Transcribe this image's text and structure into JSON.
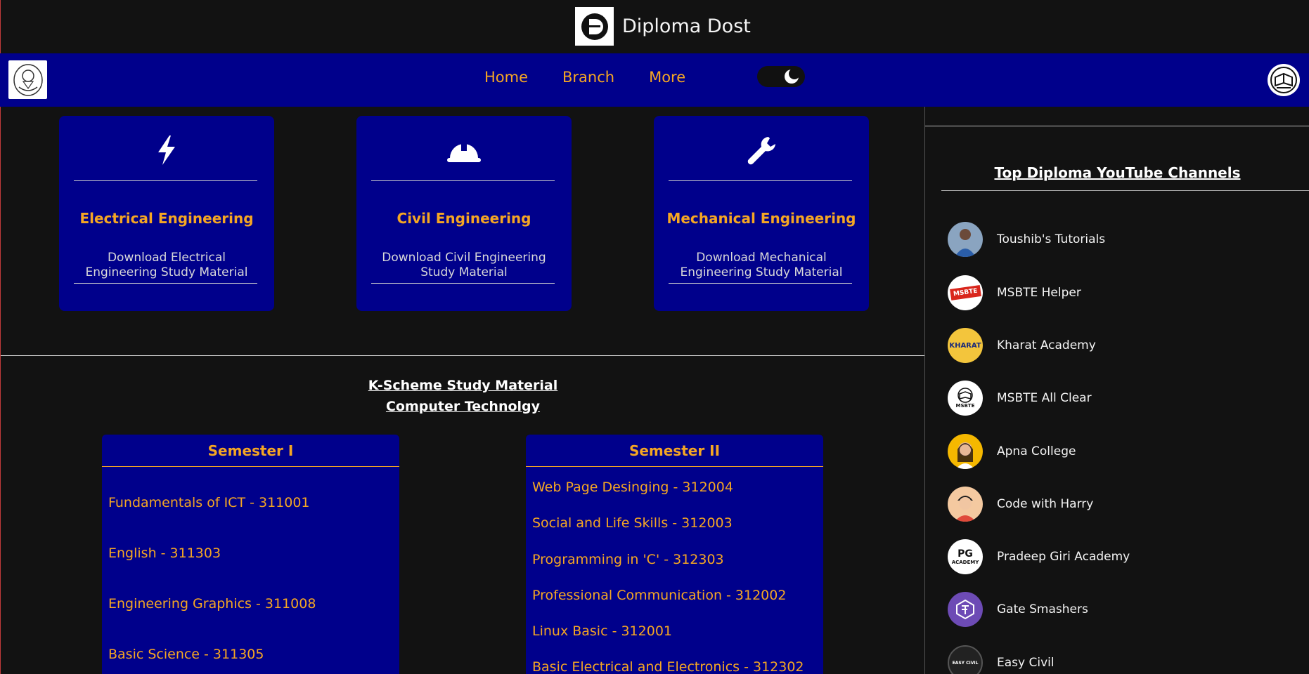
{
  "brand": {
    "name": "Diploma Dost",
    "logo_letter": "D"
  },
  "nav": {
    "links": [
      "Home",
      "Branch",
      "More"
    ],
    "toggle_icon": "moon-icon"
  },
  "branches": [
    {
      "icon": "lightning-icon",
      "title": "Electrical Engineering",
      "desc": "Download Electrical Engineering Study Material"
    },
    {
      "icon": "hard-hat-icon",
      "title": "Civil Engineering",
      "desc": "Download Civil Engineering Study Material"
    },
    {
      "icon": "wrench-icon",
      "title": "Mechanical Engineering",
      "desc": "Download Mechanical Engineering Study Material"
    }
  ],
  "kscheme": {
    "line1": "K-Scheme Study Material",
    "line2": "Computer Technolgy"
  },
  "semesters": [
    {
      "title": "Semester I",
      "items": [
        "Fundamentals of ICT - 311001",
        "English - 311303",
        "Engineering Graphics - 311008",
        "Basic Science - 311305"
      ]
    },
    {
      "title": "Semester II",
      "items": [
        "Web Page Desinging - 312004",
        "Social and Life Skills - 312003",
        "Programming in 'C' - 312303",
        "Professional Communication - 312002",
        "Linux Basic - 312001",
        "Basic Electrical and Electronics - 312302"
      ]
    }
  ],
  "sidebar": {
    "heading": "Top Diploma YouTube Channels",
    "channels": [
      {
        "name": "Toushib's Tutorials",
        "badge": "",
        "color": "#8aa4c0"
      },
      {
        "name": "MSBTE Helper",
        "badge": "MSBTE",
        "color": "#ffffff"
      },
      {
        "name": "Kharat Academy",
        "badge": "KHARAT",
        "color": "#f3c53c"
      },
      {
        "name": "MSBTE All Clear",
        "badge": "MSBTE",
        "color": "#ffffff"
      },
      {
        "name": "Apna College",
        "badge": "",
        "color": "#f5b800"
      },
      {
        "name": "Code with Harry",
        "badge": "",
        "color": "#f4c9a0"
      },
      {
        "name": "Pradeep Giri Academy",
        "badge": "ACADEMY",
        "color": "#ffffff"
      },
      {
        "name": "Gate Smashers",
        "badge": "",
        "color": "#6d4bb5"
      },
      {
        "name": "Easy Civil",
        "badge": "EASY CIVIL",
        "color": "#222222"
      }
    ]
  }
}
